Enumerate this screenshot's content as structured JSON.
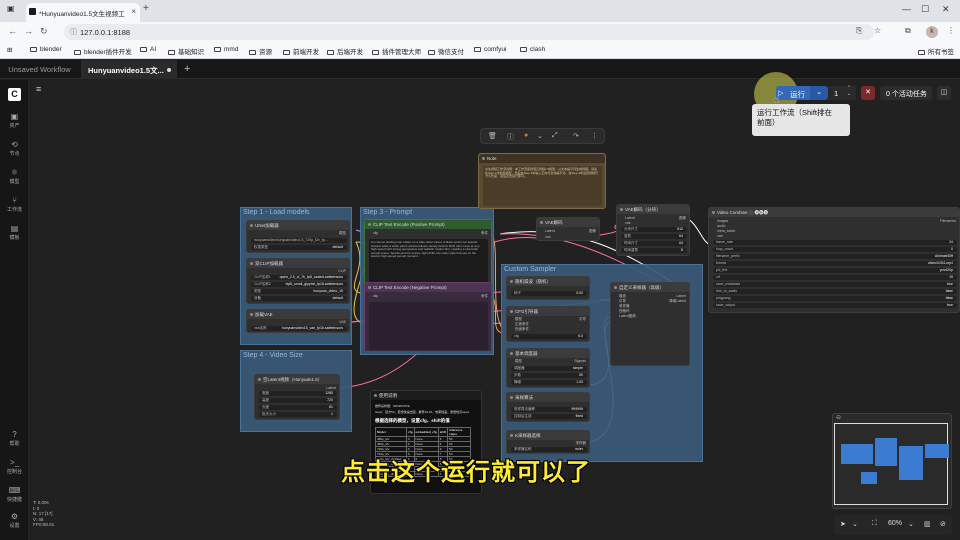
{
  "browser": {
    "tab_title": "*Hunyuanvideo1.5文生视频工",
    "url": "127.0.0.1:8188",
    "bookmarks": [
      "blender",
      "blender插件开发",
      "AI",
      "基础知识",
      "mmd",
      "资源",
      "前端开发",
      "后端开发",
      "插件管理大师",
      "微信支付",
      "comfyui",
      "clash"
    ],
    "all_bookmarks": "所有书签",
    "avatar_letter": "k"
  },
  "app": {
    "tabs": [
      {
        "label": "Unsaved Workflow"
      },
      {
        "label": "Hunyuanvideo1.5文..."
      }
    ],
    "sidebar": [
      {
        "label": "资产",
        "icon": "image-icon"
      },
      {
        "label": "节点",
        "icon": "nodes-icon"
      },
      {
        "label": "模型",
        "icon": "model-icon"
      },
      {
        "label": "工作流",
        "icon": "workflow-icon"
      },
      {
        "label": "模板",
        "icon": "template-icon"
      },
      {
        "label": "帮助",
        "icon": "help-icon"
      },
      {
        "label": "控制台",
        "icon": "console-icon"
      },
      {
        "label": "快捷键",
        "icon": "keyboard-icon"
      },
      {
        "label": "设置",
        "icon": "settings-icon"
      }
    ],
    "run_button": "运行",
    "queue_count": "1",
    "active_tasks": "0 个活动任务",
    "tooltip_line1": "运行工作流（Shift排在",
    "tooltip_line2": "前面）",
    "subtitle": "点击这个运行就可以了",
    "stats": [
      "T: 0.00s",
      "I: 0",
      "N: 17 [17]",
      "V: 48",
      "FPS:80.81"
    ],
    "zoom": "60%"
  },
  "groups": {
    "g1": "Step 1 - Load models",
    "g3": "Step 3 - Prompt",
    "g4": "Step 4 - Video Size",
    "gc": "Custom Sampler"
  },
  "nodes": {
    "unet": {
      "title": "UNet加载器",
      "f1": "hunyuanvideo\\hunyuanvideo1.5_720p_t2v_fp...",
      "f2": "权重类型",
      "f2v": "default",
      "out": "模型"
    },
    "clip": {
      "title": "双CLIP加载器",
      "f1": "CLIP名称1",
      "f1v": "qwen_2.5_vl_7b_fp8_scaled.safetensors",
      "f2": "CLIP名称2",
      "f2v": "byt5_small_glyphxl_fp16.safetensors",
      "f3": "类型",
      "f3v": "hunyuan_video_15",
      "f4": "设备",
      "f4v": "default",
      "out": "CLIP"
    },
    "vae": {
      "title": "加载VAE",
      "f1": "vae名称",
      "f1v": "hunyuanvideo15_vae_fp16.safetensors",
      "out": "VAE"
    },
    "pos": {
      "title": "CLIP Text Encode (Positive Prompt)",
      "in": "clip",
      "out": "条件",
      "text": "An intense dueling man chase on a wide urban street. A black sports car speeds forward while a white patrol vehicle follows closely behind. Both cars move at very high speed with strong perspective and realistic motion blur, creating a cinematic pursuit scene. Sparks and tire smoke, light drifts, the video style focuses on the electric high-speed pursuit moment."
    },
    "neg": {
      "title": "CLIP Text Encode (Negative Prompt)",
      "in": "clip",
      "out": "条件"
    },
    "note": {
      "title": "Note",
      "text": "文生视频工作流说明：本工作流使用混元视频1.5模型，从文本提示词生成视频。请先在Step 1中加载模型，然后在Step 3中输入正向与负向提示词，在Step 4中设置视频尺寸与长度，最后点击运行即可。"
    },
    "vaedecode": {
      "title": "VAE解码",
      "in1": "Latent",
      "in2": "vae",
      "out": "图像"
    },
    "vaedecode2": {
      "title": "VAE解码（分块）",
      "in1": "Latent",
      "in2": "vae",
      "f1": "分块尺寸",
      "f1v": "512",
      "f2": "重叠",
      "f2v": "64",
      "f3": "时间尺寸",
      "f3v": "64",
      "f4": "时间重叠",
      "f4v": "8",
      "out": "图像"
    },
    "combine": {
      "title": "Video Combine 🎥🅥🅗🅢",
      "rows": [
        [
          "images",
          ""
        ],
        [
          "audio",
          ""
        ],
        [
          "meta_batch",
          ""
        ],
        [
          "vae",
          ""
        ],
        [
          "frame_rate",
          "24"
        ],
        [
          "loop_count",
          "0"
        ],
        [
          "filename_prefix",
          "AnimateDiff"
        ],
        [
          "format",
          "video/h264-mp4"
        ],
        [
          "pix_fmt",
          "yuv420p"
        ],
        [
          "crf",
          "19"
        ],
        [
          "save_metadata",
          "true"
        ],
        [
          "trim_to_audio",
          "false"
        ],
        [
          "pingpong",
          "false"
        ],
        [
          "save_output",
          "true"
        ]
      ],
      "out": "Filenames"
    },
    "noise": {
      "title": "随机噪波（随机）",
      "f1": "种子",
      "f1v": "0.00"
    },
    "cfg": {
      "title": "CFG引导器",
      "in1": "模型",
      "in2": "正面条件",
      "in3": "负面条件",
      "f1": "cfg",
      "f1v": "6.0",
      "out": "引导"
    },
    "custom": {
      "title": "自定义采样器（高级）",
      "in": [
        "噪波",
        "引导",
        "采样器",
        "西格玛",
        "Latent图像"
      ],
      "out1": "Latent",
      "out2": "降噪Latent"
    },
    "sched": {
      "title": "基本调度器",
      "in": "模型",
      "f1": "调度器",
      "f1v": "simple",
      "f2": "步数",
      "f2v": "50",
      "f3": "降噪",
      "f3v": "1.00",
      "out": "Sigmas"
    },
    "shift": {
      "title": "采样算法",
      "f1": "采样算法偏移",
      "f1v": "999999",
      "f2": "控制后生成",
      "f2v": "fixed"
    },
    "ksel": {
      "title": "K采样器选择",
      "f1": "采样器名称",
      "f1v": "euler",
      "out": "采样器"
    },
    "latent": {
      "title": "空Latent视频（Hunyuan1.5）",
      "f1": "宽度",
      "f1v": "1280",
      "f2": "高度",
      "f2v": "720",
      "f3": "长度",
      "f3v": "81",
      "f4": "批次大小",
      "f4v": "1",
      "out": "Latent"
    },
    "tips": {
      "title": "使用说明",
      "line1": "推荐采样器：SPARK/STE",
      "line2": "steps：官方50，若想快速出图，推荐10-15，效果较差，质量较高steps",
      "line3": "根据选择的模型，设置cfg、shift的值",
      "headers": [
        "Model",
        "cfg",
        "embedded_cfg",
        "shift",
        "inference steps"
      ],
      "rows": [
        [
          "480p_t2v",
          "6",
          "None",
          "5",
          "50"
        ],
        [
          "480p_i2v",
          "6",
          "None",
          "5",
          "50"
        ],
        [
          "720p_t2v",
          "6",
          "None",
          "9",
          "50"
        ],
        [
          "720p_i2v",
          "6",
          "None",
          "7",
          "50"
        ],
        [
          "480p_t2v_distilled",
          "1",
          "6",
          "5",
          "50"
        ],
        [
          "480p_i2v_distilled",
          "1",
          "None",
          "5",
          "50"
        ],
        [
          "720p_i2v_distilled",
          "1",
          "None",
          "7",
          "50"
        ],
        [
          "720p_i2v_distilled_sr",
          "1",
          "None",
          "7",
          "50"
        ]
      ]
    }
  }
}
